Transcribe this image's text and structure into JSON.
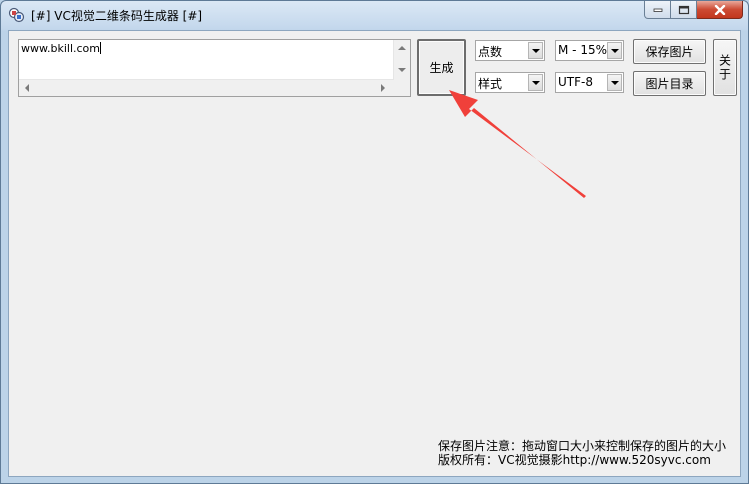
{
  "window": {
    "title": "[#] VC视觉二维条码生成器 [#]"
  },
  "input": {
    "value": "www.bkill.com"
  },
  "buttons": {
    "generate": "生成",
    "save_image": "保存图片",
    "image_dir": "图片目录",
    "about": "关于"
  },
  "selects": {
    "points": "点数",
    "error_correction": "M - 15%",
    "style": "样式",
    "encoding": "UTF-8"
  },
  "notes": {
    "line1": "保存图片注意：拖动窗口大小来控制保存的图片的大小",
    "line2": "版权所有：VC视觉摄影http://www.520syvc.com"
  },
  "colors": {
    "annotation_arrow": "#f0403a"
  }
}
